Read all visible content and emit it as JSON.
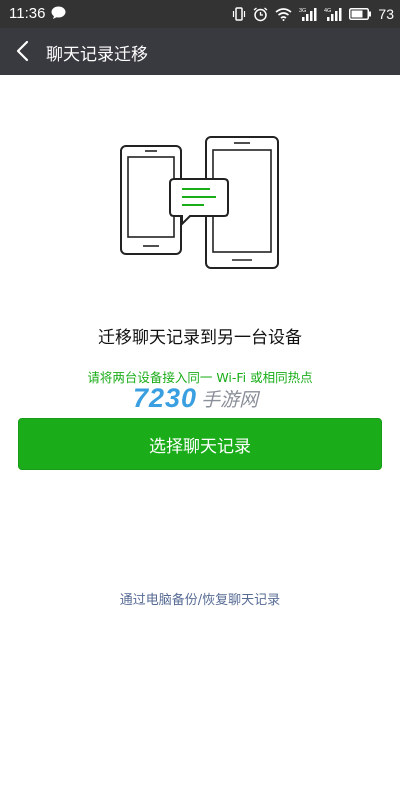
{
  "status_bar": {
    "time": "11:36",
    "battery": "73",
    "icons": [
      "message-icon",
      "vibrate-icon",
      "alarm-icon",
      "wifi-icon",
      "signal-3g-icon",
      "signal-4g-icon",
      "battery-icon"
    ],
    "network_labels": [
      "3G",
      "4G"
    ]
  },
  "top_bar": {
    "back_icon": "back-arrow-icon",
    "title": "聊天记录迁移"
  },
  "illustration": {
    "icon": "phone-to-tablet-chat-illustration",
    "accent": "#1aad19"
  },
  "main": {
    "heading": "迁移聊天记录到另一台设备",
    "subtext": "请将两台设备接入同一 Wi-Fi 或相同热点",
    "primary_button": "选择聊天记录",
    "backup_link": "通过电脑备份/恢复聊天记录"
  },
  "watermark": {
    "number": "7230",
    "text": "手游网"
  },
  "colors": {
    "status_bar": "#333333",
    "top_bar": "#393a3f",
    "accent": "#1aad19",
    "link": "#576b95"
  }
}
